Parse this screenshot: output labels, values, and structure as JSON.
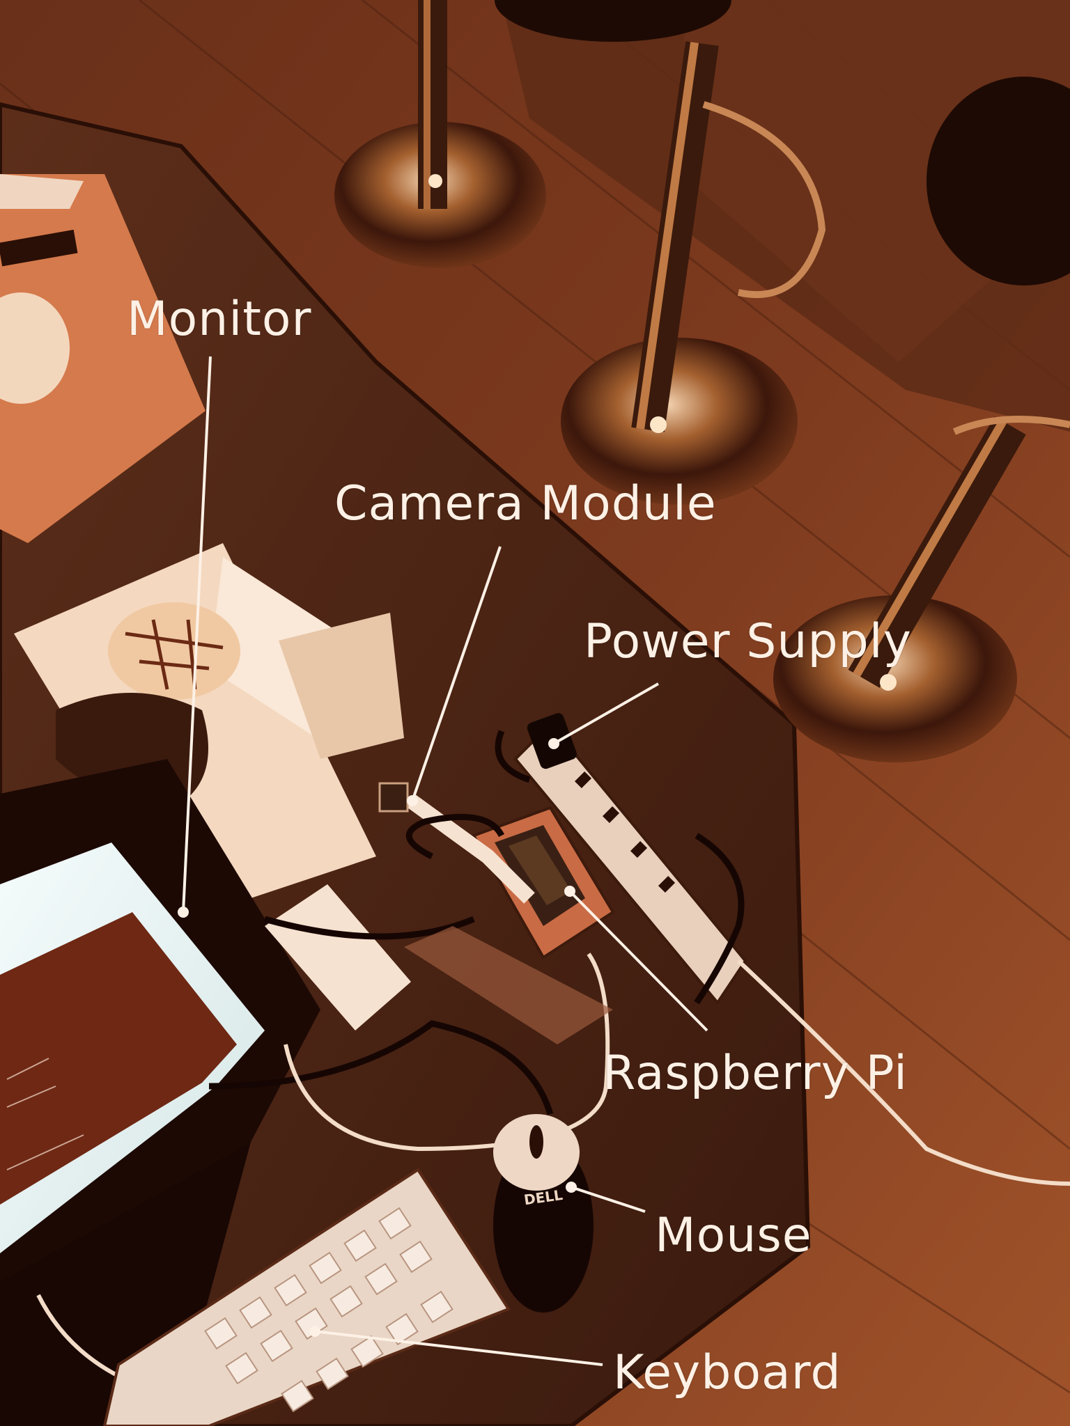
{
  "annotations": {
    "monitor": "Monitor",
    "camera_module": "Camera Module",
    "power_supply": "Power Supply",
    "raspberry_pi": "Raspberry Pi",
    "mouse": "Mouse",
    "keyboard": "Keyboard"
  },
  "product_marks": {
    "mouse_brand": "DELL"
  },
  "colors": {
    "label_text": "#fdf1e6",
    "leader_line": "#fdf1e6",
    "floor_dark": "#4a2010",
    "floor_mid": "#7a3a20",
    "table_top": "#6b3a25",
    "chrome_highlight": "#f6d8b8",
    "monitor_screen": "#eaf4f4"
  }
}
